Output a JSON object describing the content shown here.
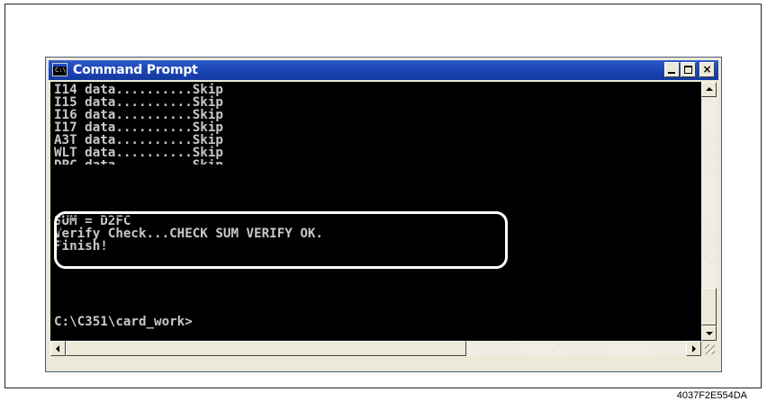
{
  "window": {
    "title": "Command Prompt",
    "icon": "console-icon",
    "icon_glyph": "C:\\",
    "controls": {
      "minimize": "minimize-icon",
      "maximize": "maximize-icon",
      "close": "close-icon",
      "close_glyph": "×"
    }
  },
  "console": {
    "lines": [
      "I14 data..........Skip",
      "I15 data..........Skip",
      "I16 data..........Skip",
      "I17 data..........Skip",
      "A3T data..........Skip",
      "WLT data..........Skip",
      "DPC data..........Skip",
      "SUM = D2FC",
      "Verify Check...CHECK SUM VERIFY OK.",
      "Finish!",
      "C:\\C351\\card_work>"
    ],
    "text_color": "#c8c8c8",
    "background": "#000000"
  },
  "scrollbars": {
    "vertical": {
      "up": "arrow-up-icon",
      "down": "arrow-down-icon"
    },
    "horizontal": {
      "left": "arrow-left-icon",
      "right": "arrow-right-icon"
    }
  },
  "figure": {
    "id": "4037F2E554DA"
  },
  "colors": {
    "titlebar": "#1d46b8",
    "window_face": "#ece9d8",
    "highlight": "#ffffff"
  }
}
